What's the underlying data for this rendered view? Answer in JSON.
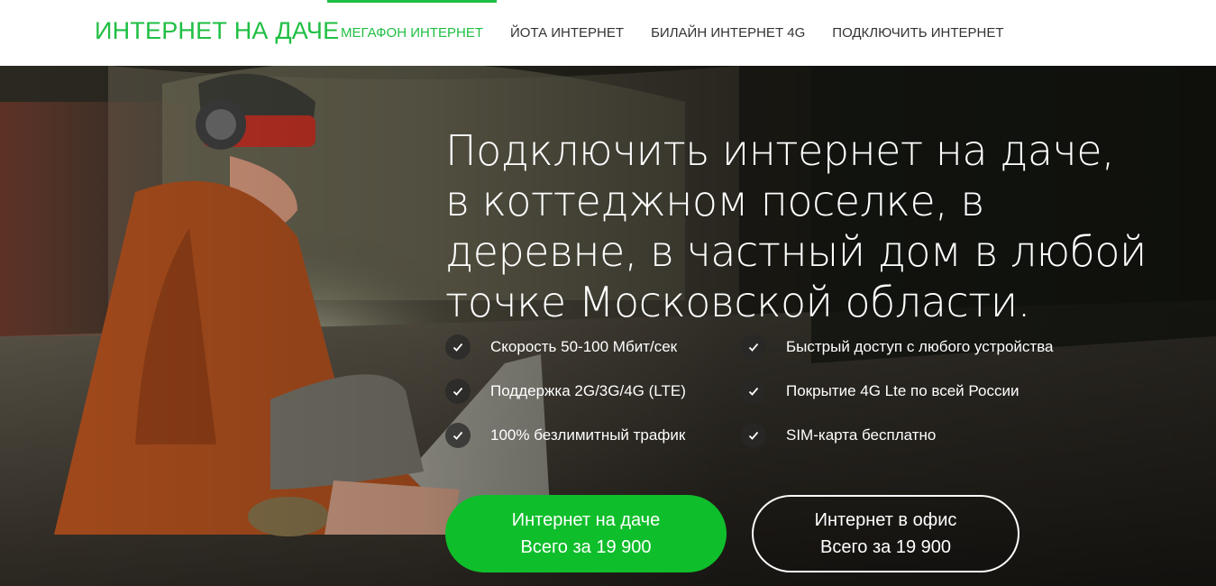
{
  "header": {
    "logo": "ИНТЕРНЕТ НА ДАЧЕ",
    "nav": [
      {
        "label": "МЕГАФОН ИНТЕРНЕТ",
        "active": true
      },
      {
        "label": "ЙОТА ИНТЕРНЕТ",
        "active": false
      },
      {
        "label": "БИЛАЙН ИНТЕРНЕТ 4G",
        "active": false
      },
      {
        "label": "ПОДКЛЮЧИТЬ ИНТЕРНЕТ",
        "active": false
      }
    ]
  },
  "hero": {
    "headline": "Подключить интернет на даче, в коттеджном поселке, в деревне, в частный дом в любой точке Московской области.",
    "features": [
      "Скорость 50-100 Мбит/сек",
      "Поддержка 2G/3G/4G (LTE)",
      "100% безлимитный трафик",
      "Быстрый доступ с любого устройства",
      "Покрытие 4G Lte по всей России",
      "SIM-карта бесплатно"
    ],
    "cta_primary": {
      "line1": "Интернет на даче",
      "line2": "Всего за 19 900"
    },
    "cta_secondary": {
      "line1": "Интернет в офис",
      "line2": "Всего за 19 900"
    }
  },
  "colors": {
    "brand_green": "#1fbf43",
    "button_green": "#0fbe2b"
  },
  "icons": {
    "feature_icon": "check-icon"
  }
}
